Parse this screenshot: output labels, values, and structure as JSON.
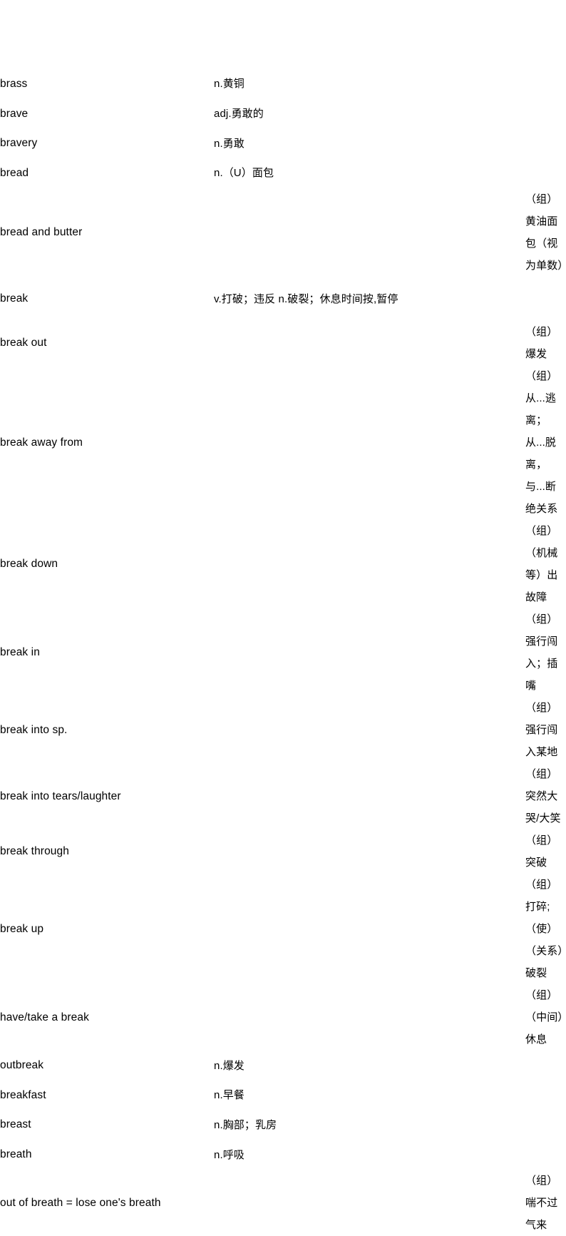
{
  "document": {
    "type": "vocabulary-list",
    "columns": [
      "term",
      "definition"
    ],
    "entries": [
      {
        "term": "brass",
        "definition": "n.黄铜",
        "style": "plain",
        "wrapped": false
      },
      {
        "term": "brave",
        "definition": "adj.勇敢的",
        "style": "plain",
        "wrapped": false
      },
      {
        "term": "bravery",
        "definition": "n.勇敢",
        "style": "plain",
        "wrapped": false
      },
      {
        "term": "bread",
        "definition": "n.（U）面包",
        "style": "plain",
        "wrapped": false
      },
      {
        "term": "bread and butter",
        "definition": "（组）黄油面包（视为单数）",
        "style": "indent",
        "wrapped": false
      },
      {
        "term": "break",
        "definition": "v.打破；违反 n.破裂；休息时间按,暂停",
        "style": "plain",
        "wrapped": true
      },
      {
        "term": "break out",
        "definition": "（组）爆发",
        "style": "indent",
        "wrapped": false
      },
      {
        "term": "break away from",
        "definition": "（组）从...逃离；从...脱离，与...断绝关系",
        "style": "indent",
        "wrapped": true
      },
      {
        "term": "break down",
        "definition": "（组）（机械等）出故障",
        "style": "indent",
        "wrapped": false
      },
      {
        "term": "break in",
        "definition": "（组）强行闯入；插嘴",
        "style": "indent",
        "wrapped": false
      },
      {
        "term": "break into sp.",
        "definition": "（组）强行闯入某地",
        "style": "indent",
        "wrapped": false
      },
      {
        "term": "break into tears/laughter",
        "definition": "（组）突然大哭/大笑",
        "style": "indent",
        "wrapped": false
      },
      {
        "term": "break through",
        "definition": "（组）突破",
        "style": "indent",
        "wrapped": false
      },
      {
        "term": "break up",
        "definition": "（组）打碎;（使）（关系）破裂",
        "style": "indent",
        "wrapped": false
      },
      {
        "term": "have/take a break",
        "definition": "（组）（中间）休息",
        "style": "indent",
        "wrapped": false
      },
      {
        "term": "outbreak",
        "definition": "n.爆发",
        "style": "plain",
        "wrapped": false
      },
      {
        "term": "breakfast",
        "definition": "n.早餐",
        "style": "plain",
        "wrapped": false
      },
      {
        "term": "breast",
        "definition": "n.胸部；乳房",
        "style": "plain",
        "wrapped": false
      },
      {
        "term": "breath",
        "definition": "n.呼吸",
        "style": "plain",
        "wrapped": false
      },
      {
        "term": "out of breath = lose one's breath",
        "definition": "（组）喘不过气来",
        "style": "indent",
        "wrapped": false
      }
    ]
  }
}
